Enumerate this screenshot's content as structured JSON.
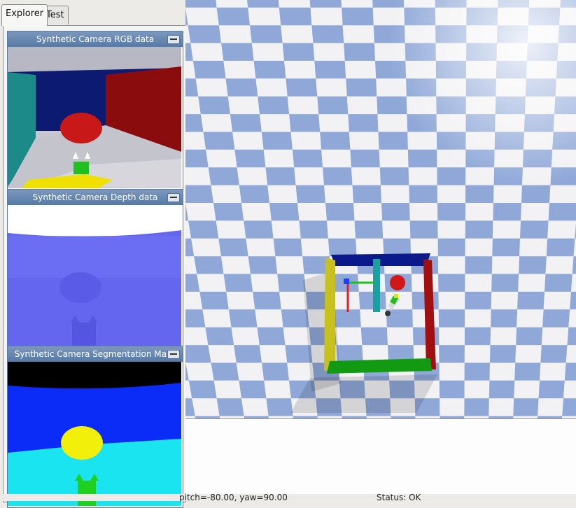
{
  "tabs": [
    {
      "label": "Explorer",
      "active": true
    },
    {
      "label": "Test",
      "active": false
    }
  ],
  "panels": {
    "rgb": {
      "title": "Synthetic Camera RGB data",
      "icon": "minimize-icon"
    },
    "depth": {
      "title": "Synthetic Camera Depth data",
      "icon": "minimize-icon"
    },
    "segmentation": {
      "title": "Synthetic Camera Segmentation Mask",
      "icon": "minimize-icon"
    }
  },
  "status": {
    "camera_readout": "pitch=-80.00, yaw=90.00",
    "status_text": "Status: OK"
  },
  "colors": {
    "checker_light": "#f2f2f4",
    "checker_dark": "#8fa8d8",
    "wall_red": "#a01010",
    "wall_blue": "#0a1a8a",
    "wall_green": "#129a12",
    "wall_yellow": "#c8c020",
    "ball_red": "#d01818",
    "depth_blue": "#6a6cf2",
    "seg_blue": "#0b2cf7",
    "seg_cyan": "#19e4f0",
    "seg_yellow": "#f2ef0a"
  }
}
